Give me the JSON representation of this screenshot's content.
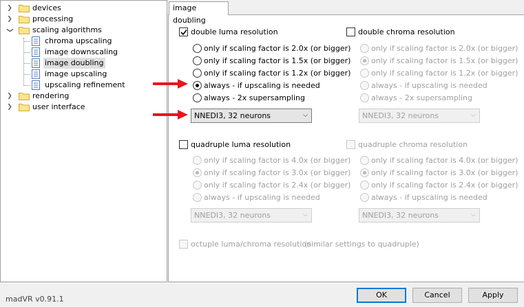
{
  "tree": {
    "items": [
      {
        "label": "devices",
        "kind": "folder",
        "expanded": false,
        "selected": false
      },
      {
        "label": "processing",
        "kind": "folder",
        "expanded": false,
        "selected": false
      },
      {
        "label": "scaling algorithms",
        "kind": "folder",
        "expanded": true,
        "selected": false
      },
      {
        "label": "chroma upscaling",
        "kind": "page",
        "selected": false
      },
      {
        "label": "image downscaling",
        "kind": "page",
        "selected": false
      },
      {
        "label": "image doubling",
        "kind": "page",
        "selected": true
      },
      {
        "label": "image upscaling",
        "kind": "page",
        "selected": false
      },
      {
        "label": "upscaling refinement",
        "kind": "page",
        "selected": false
      },
      {
        "label": "rendering",
        "kind": "folder",
        "expanded": false,
        "selected": false
      },
      {
        "label": "user interface",
        "kind": "folder",
        "expanded": false,
        "selected": false
      }
    ]
  },
  "tab": {
    "label": "image doubling"
  },
  "double_luma": {
    "label": "double luma resolution",
    "checked": true,
    "options": [
      "only if scaling factor is 2.0x (or bigger)",
      "only if scaling factor is 1.5x (or bigger)",
      "only if scaling factor is 1.2x (or bigger)",
      "always - if upscaling is needed",
      "always - 2x supersampling"
    ],
    "selected_index": 3,
    "algorithm": "NNEDI3, 32 neurons"
  },
  "double_chroma": {
    "label": "double chroma resolution",
    "checked": false,
    "options": [
      "only if scaling factor is 2.0x (or bigger)",
      "only if scaling factor is 1.5x (or bigger)",
      "only if scaling factor is 1.2x (or bigger)",
      "always - if upscaling is needed",
      "always - 2x supersampling"
    ],
    "selected_index": 1,
    "algorithm": "NNEDI3, 32 neurons"
  },
  "quad_luma": {
    "label": "quadruple luma resolution",
    "checked": false,
    "options": [
      "only if scaling factor is 4.0x (or bigger)",
      "only if scaling factor is 3.0x (or bigger)",
      "only if scaling factor is 2.4x (or bigger)",
      "always - if upscaling is needed"
    ],
    "selected_index": 1,
    "algorithm": "NNEDI3, 32 neurons"
  },
  "quad_chroma": {
    "label": "quadruple chroma resolution",
    "checked": false,
    "options": [
      "only if scaling factor is 4.0x (or bigger)",
      "only if scaling factor is 3.0x (or bigger)",
      "only if scaling factor is 2.4x (or bigger)",
      "always - if upscaling is needed"
    ],
    "selected_index": 1,
    "algorithm": "NNEDI3, 32 neurons"
  },
  "octuple": {
    "label": "octuple luma/chroma resolution",
    "note": "(similar settings to quadruple)",
    "checked": false
  },
  "footer": {
    "version": "madVR v0.91.1",
    "ok_label": "OK",
    "cancel_label": "Cancel",
    "apply_label": "Apply"
  },
  "colors": {
    "arrow": "#e8161b",
    "selection": "#e0e0e0",
    "focus_border": "#0078d7"
  },
  "icons": {
    "folder": "folder-icon",
    "page": "page-icon",
    "expand": "chevron-right-icon",
    "collapse": "chevron-down-icon"
  }
}
